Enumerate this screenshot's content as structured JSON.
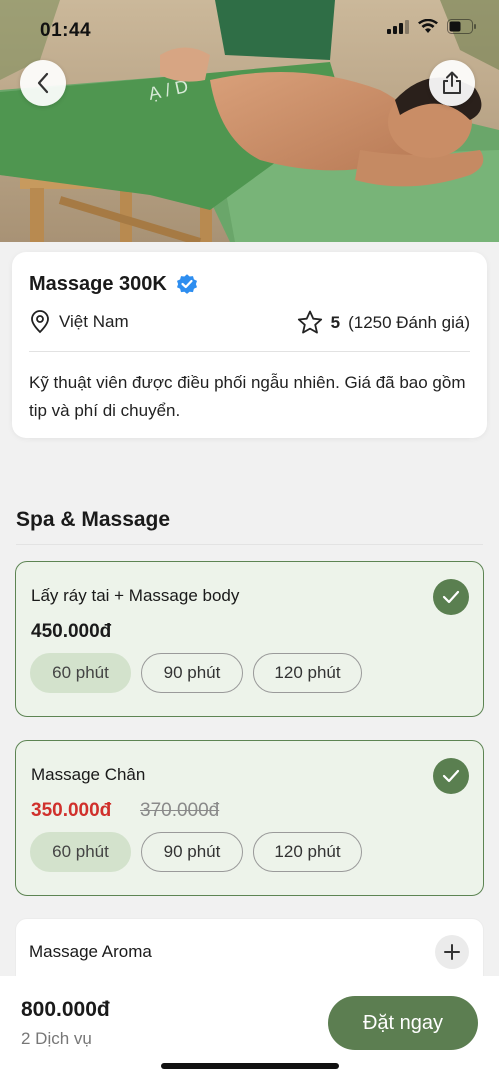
{
  "status_bar": {
    "time": "01:44"
  },
  "provider": {
    "title": "Massage 300K",
    "location": "Việt Nam",
    "rating": "5",
    "reviews": "(1250 Đánh giá)",
    "description": "Kỹ thuật viên được điều phối ngẫu nhiên. Giá đã bao gồm tip và phí di chuyển."
  },
  "section": {
    "title": "Spa & Massage"
  },
  "services": [
    {
      "name": "Lấy ráy tai + Massage body",
      "price": "450.000đ",
      "selected": true,
      "durations": [
        "60 phút",
        "90 phút",
        "120 phút"
      ]
    },
    {
      "name": "Massage Chân",
      "price": "350.000đ",
      "old_price": "370.000đ",
      "selected": true,
      "durations": [
        "60 phút",
        "90 phút",
        "120 phút"
      ]
    },
    {
      "name": "Massage Aroma",
      "selected": false
    }
  ],
  "footer": {
    "total": "800.000đ",
    "count": "2 Dịch vụ",
    "book_label": "Đặt ngay"
  },
  "colors": {
    "accent": "#5c7e51",
    "selected_bg": "#edf3ea",
    "chip_active": "#d3e2cc",
    "sale_price": "#d0302c",
    "verified": "#2e8ef0"
  },
  "icons": [
    "back-arrow-icon",
    "share-icon",
    "verified-icon",
    "location-pin-icon",
    "star-icon",
    "check-icon",
    "plus-icon"
  ]
}
